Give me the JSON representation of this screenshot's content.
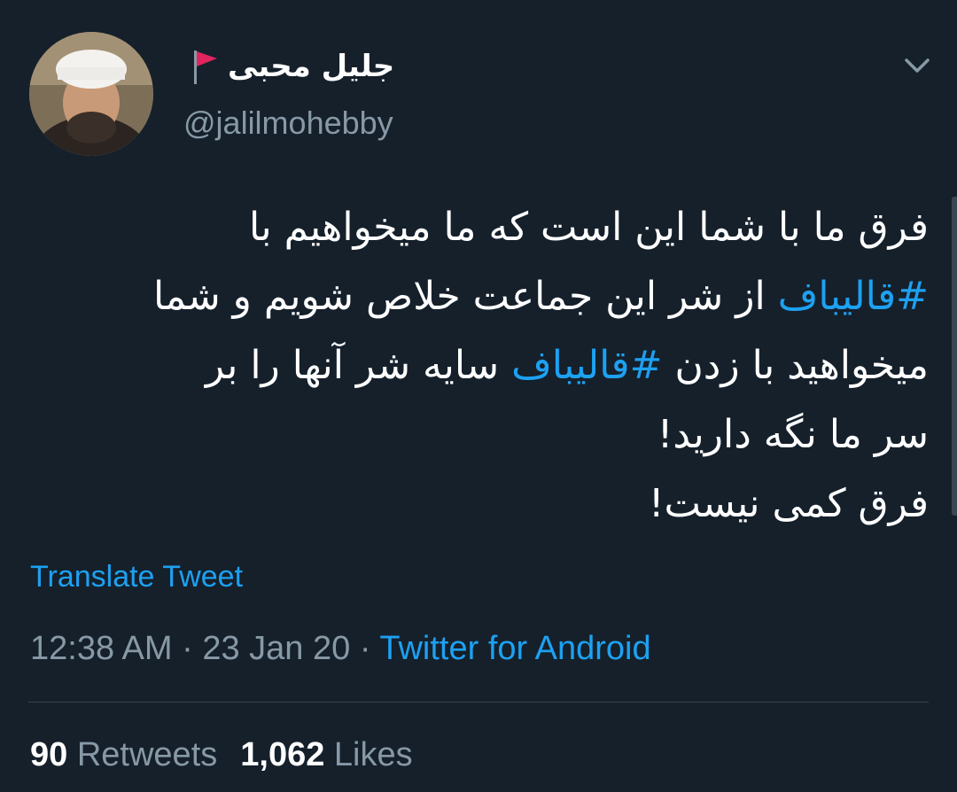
{
  "author": {
    "display_name": "جلیل محبی",
    "handle": "@jalilmohebby",
    "flag_icon": "red-flag-icon",
    "avatar_icon": "profile-photo"
  },
  "tweet": {
    "lines": [
      [
        {
          "text": "فرق ما با شما این است که ما میخواهیم با",
          "hashtag": false
        }
      ],
      [
        {
          "text": "#قالیباف",
          "hashtag": true
        },
        {
          "text": " از شر این جماعت خلاص شویم و شما",
          "hashtag": false
        }
      ],
      [
        {
          "text": "میخواهید با زدن ",
          "hashtag": false
        },
        {
          "text": "#قالیباف",
          "hashtag": true
        },
        {
          "text": " سایه شر آنها را بر",
          "hashtag": false
        }
      ],
      [
        {
          "text": "سر ما نگه دارید!",
          "hashtag": false
        }
      ],
      [
        {
          "text": "فرق کمی نیست!",
          "hashtag": false
        }
      ]
    ]
  },
  "translate_label": "Translate Tweet",
  "meta": {
    "time": "12:38 AM",
    "separator": " · ",
    "date": "23 Jan 20",
    "source": "Twitter for Android"
  },
  "stats": {
    "retweets_count": "90",
    "retweets_label": "Retweets",
    "likes_count": "1,062",
    "likes_label": "Likes"
  },
  "colors": {
    "background": "#15202b",
    "link": "#1da1f2",
    "secondary_text": "#8899a6",
    "flag": "#e0245e"
  }
}
